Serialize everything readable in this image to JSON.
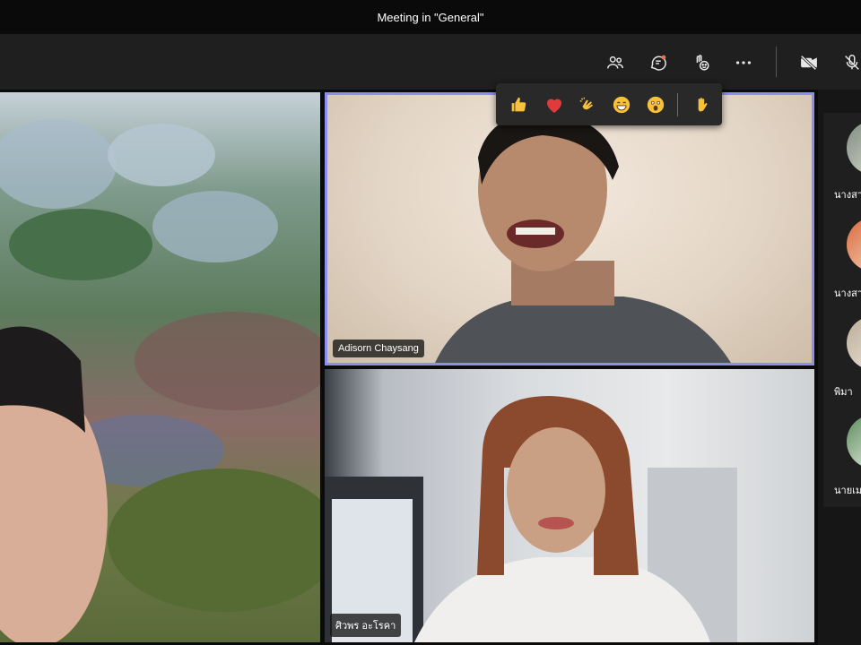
{
  "window": {
    "title": "Meeting in \"General\""
  },
  "toolbar": {
    "icons": [
      "participants-icon",
      "chat-icon",
      "reactions-icon",
      "more-icon",
      "camera-off-icon",
      "mic-off-icon"
    ]
  },
  "reactions": {
    "items": [
      "like-icon",
      "heart-icon",
      "applause-icon",
      "laugh-icon",
      "surprised-icon"
    ],
    "raise_hand": "raise-hand-icon"
  },
  "tiles": [
    {
      "name": ""
    },
    {
      "name": "Adisorn Chaysang"
    },
    {
      "name": "ศิวพร อะโรคา"
    }
  ],
  "rail": {
    "participants": [
      {
        "name": "นางสา"
      },
      {
        "name": "นางสา"
      },
      {
        "name": "พิมา"
      },
      {
        "name": "นายเม"
      }
    ]
  },
  "colors": {
    "active_speaker_border": "#8c8ef0",
    "accent_dot": "#e9755b",
    "heart": "#e03a3a",
    "emoji_yellow": "#f7c23a"
  }
}
